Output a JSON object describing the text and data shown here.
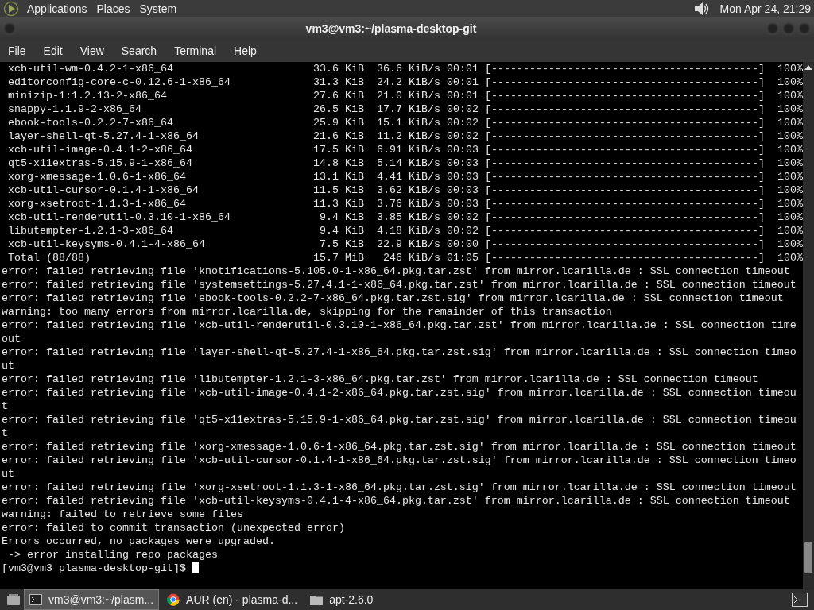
{
  "top_panel": {
    "menus": [
      "Applications",
      "Places",
      "System"
    ],
    "clock": "Mon Apr 24, 21:29"
  },
  "window": {
    "title": "vm3@vm3:~/plasma-desktop-git"
  },
  "menu_bar": [
    "File",
    "Edit",
    "View",
    "Search",
    "Terminal",
    "Help"
  ],
  "downloads": [
    {
      "name": "xcb-util-wm-0.4.2-1-x86_64",
      "size": "33.6 KiB",
      "speed": "36.6 KiB/s",
      "time": "00:01",
      "bar": "[------------------------------------------]",
      "percent": "100%"
    },
    {
      "name": "editorconfig-core-c-0.12.6-1-x86_64",
      "size": "31.3 KiB",
      "speed": "24.2 KiB/s",
      "time": "00:01",
      "bar": "[------------------------------------------]",
      "percent": "100%"
    },
    {
      "name": "minizip-1:1.2.13-2-x86_64",
      "size": "27.6 KiB",
      "speed": "21.0 KiB/s",
      "time": "00:01",
      "bar": "[------------------------------------------]",
      "percent": "100%"
    },
    {
      "name": "snappy-1.1.9-2-x86_64",
      "size": "26.5 KiB",
      "speed": "17.7 KiB/s",
      "time": "00:02",
      "bar": "[------------------------------------------]",
      "percent": "100%"
    },
    {
      "name": "ebook-tools-0.2.2-7-x86_64",
      "size": "25.9 KiB",
      "speed": "15.1 KiB/s",
      "time": "00:02",
      "bar": "[------------------------------------------]",
      "percent": "100%"
    },
    {
      "name": "layer-shell-qt-5.27.4-1-x86_64",
      "size": "21.6 KiB",
      "speed": "11.2 KiB/s",
      "time": "00:02",
      "bar": "[------------------------------------------]",
      "percent": "100%"
    },
    {
      "name": "xcb-util-image-0.4.1-2-x86_64",
      "size": "17.5 KiB",
      "speed": "6.91 KiB/s",
      "time": "00:03",
      "bar": "[------------------------------------------]",
      "percent": "100%"
    },
    {
      "name": "qt5-x11extras-5.15.9-1-x86_64",
      "size": "14.8 KiB",
      "speed": "5.14 KiB/s",
      "time": "00:03",
      "bar": "[------------------------------------------]",
      "percent": "100%"
    },
    {
      "name": "xorg-xmessage-1.0.6-1-x86_64",
      "size": "13.1 KiB",
      "speed": "4.41 KiB/s",
      "time": "00:03",
      "bar": "[------------------------------------------]",
      "percent": "100%"
    },
    {
      "name": "xcb-util-cursor-0.1.4-1-x86_64",
      "size": "11.5 KiB",
      "speed": "3.62 KiB/s",
      "time": "00:03",
      "bar": "[------------------------------------------]",
      "percent": "100%"
    },
    {
      "name": "xorg-xsetroot-1.1.3-1-x86_64",
      "size": "11.3 KiB",
      "speed": "3.76 KiB/s",
      "time": "00:03",
      "bar": "[------------------------------------------]",
      "percent": "100%"
    },
    {
      "name": "xcb-util-renderutil-0.3.10-1-x86_64",
      "size": "9.4 KiB",
      "speed": "3.85 KiB/s",
      "time": "00:02",
      "bar": "[------------------------------------------]",
      "percent": "100%"
    },
    {
      "name": "libutempter-1.2.1-3-x86_64",
      "size": "9.4 KiB",
      "speed": "4.18 KiB/s",
      "time": "00:02",
      "bar": "[------------------------------------------]",
      "percent": "100%"
    },
    {
      "name": "xcb-util-keysyms-0.4.1-4-x86_64",
      "size": "7.5 KiB",
      "speed": "22.9 KiB/s",
      "time": "00:00",
      "bar": "[------------------------------------------]",
      "percent": "100%"
    },
    {
      "name": "Total (88/88)",
      "size": "15.7 MiB",
      "speed": "246 KiB/s",
      "time": "01:05",
      "bar": "[------------------------------------------]",
      "percent": "100%"
    }
  ],
  "output_lines": [
    "error: failed retrieving file 'knotifications-5.105.0-1-x86_64.pkg.tar.zst' from mirror.lcarilla.de : SSL connection timeout",
    "error: failed retrieving file 'systemsettings-5.27.4.1-1-x86_64.pkg.tar.zst' from mirror.lcarilla.de : SSL connection timeout",
    "error: failed retrieving file 'ebook-tools-0.2.2-7-x86_64.pkg.tar.zst.sig' from mirror.lcarilla.de : SSL connection timeout",
    "warning: too many errors from mirror.lcarilla.de, skipping for the remainder of this transaction",
    "error: failed retrieving file 'xcb-util-renderutil-0.3.10-1-x86_64.pkg.tar.zst' from mirror.lcarilla.de : SSL connection time",
    "out",
    "error: failed retrieving file 'layer-shell-qt-5.27.4-1-x86_64.pkg.tar.zst.sig' from mirror.lcarilla.de : SSL connection timeo",
    "ut",
    "error: failed retrieving file 'libutempter-1.2.1-3-x86_64.pkg.tar.zst' from mirror.lcarilla.de : SSL connection timeout",
    "error: failed retrieving file 'xcb-util-image-0.4.1-2-x86_64.pkg.tar.zst.sig' from mirror.lcarilla.de : SSL connection timeou",
    "t",
    "error: failed retrieving file 'qt5-x11extras-5.15.9-1-x86_64.pkg.tar.zst.sig' from mirror.lcarilla.de : SSL connection timeou",
    "t",
    "error: failed retrieving file 'xorg-xmessage-1.0.6-1-x86_64.pkg.tar.zst.sig' from mirror.lcarilla.de : SSL connection timeout",
    "error: failed retrieving file 'xcb-util-cursor-0.1.4-1-x86_64.pkg.tar.zst.sig' from mirror.lcarilla.de : SSL connection timeo",
    "ut",
    "error: failed retrieving file 'xorg-xsetroot-1.1.3-1-x86_64.pkg.tar.zst.sig' from mirror.lcarilla.de : SSL connection timeout",
    "error: failed retrieving file 'xcb-util-keysyms-0.4.1-4-x86_64.pkg.tar.zst' from mirror.lcarilla.de : SSL connection timeout",
    "warning: failed to retrieve some files",
    "error: failed to commit transaction (unexpected error)",
    "Errors occurred, no packages were upgraded.",
    " -> error installing repo packages"
  ],
  "prompt": "[vm3@vm3 plasma-desktop-git]$ ",
  "taskbar": [
    {
      "label": "vm3@vm3:~/plasm...",
      "kind": "terminal",
      "selected": true
    },
    {
      "label": "AUR (en) - plasma-d...",
      "kind": "browser",
      "selected": false
    },
    {
      "label": "apt-2.6.0",
      "kind": "folder",
      "selected": false
    }
  ]
}
